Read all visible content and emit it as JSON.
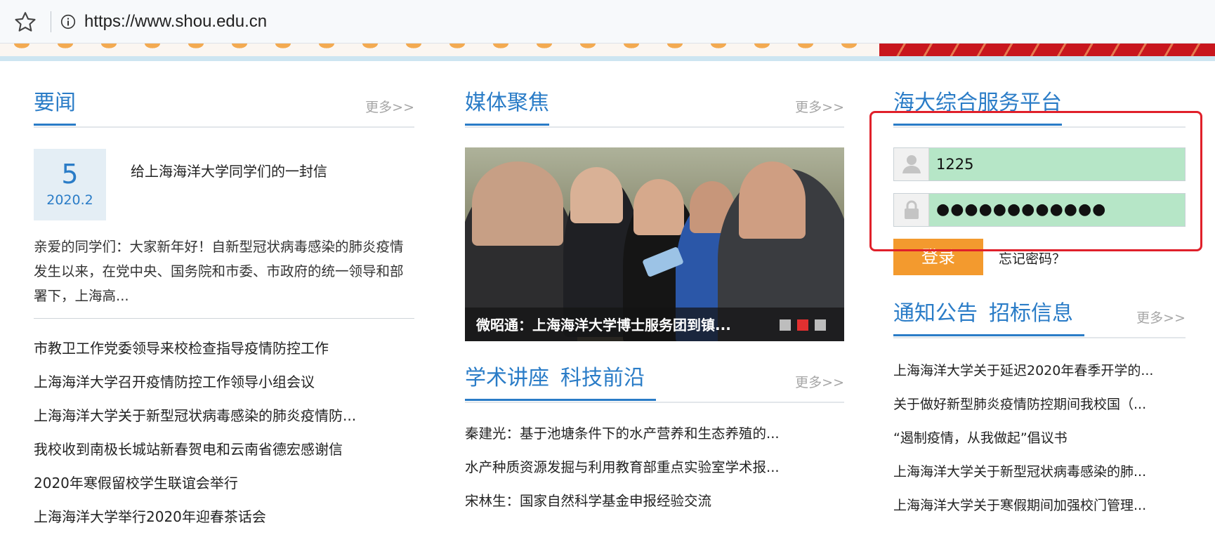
{
  "browser": {
    "url": "https://www.shou.edu.cn"
  },
  "colors": {
    "accent": "#2a7cc7",
    "login_button": "#f39a2e",
    "highlight": "#e0202a",
    "field_fill": "#b6e6c7"
  },
  "news": {
    "title": "要闻",
    "more": "更多>>",
    "lead": {
      "day": "5",
      "month": "2020.2",
      "title": "给上海海洋大学同学们的一封信",
      "summary": "亲爱的同学们：大家新年好！自新型冠状病毒感染的肺炎疫情发生以来，在党中央、国务院和市委、市政府的统一领导和部署下，上海高..."
    },
    "items": [
      "市教卫工作党委领导来校检查指导疫情防控工作",
      "上海海洋大学召开疫情防控工作领导小组会议",
      "上海海洋大学关于新型冠状病毒感染的肺炎疫情防...",
      "我校收到南极长城站新春贺电和云南省德宏感谢信",
      "2020年寒假留校学生联谊会举行",
      "上海海洋大学举行2020年迎春茶话会"
    ]
  },
  "media": {
    "title": "媒体聚焦",
    "more": "更多>>",
    "slide_caption": "微昭通：上海海洋大学博士服务团到镇...",
    "slide_count": 3,
    "active_slide": 2
  },
  "academic": {
    "tabs": [
      "学术讲座",
      "科技前沿"
    ],
    "more": "更多>>",
    "items": [
      "秦建光：基于池塘条件下的水产营养和生态养殖的...",
      "水产种质资源发掘与利用教育部重点实验室学术报...",
      "宋林生：国家自然科学基金申报经验交流"
    ]
  },
  "platform": {
    "title": "海大综合服务平台",
    "username_value": "1225",
    "password_mask": "●●●●●●●●●●●●",
    "login_label": "登录",
    "forgot_label": "忘记密码？"
  },
  "notices": {
    "tabs": [
      "通知公告",
      "招标信息"
    ],
    "more": "更多>>",
    "items": [
      "上海海洋大学关于延迟2020年春季开学的...",
      "关于做好新型肺炎疫情防控期间我校国（...",
      "“遏制疫情，从我做起”倡议书",
      "上海海洋大学关于新型冠状病毒感染的肺...",
      "上海海洋大学关于寒假期间加强校门管理..."
    ]
  }
}
